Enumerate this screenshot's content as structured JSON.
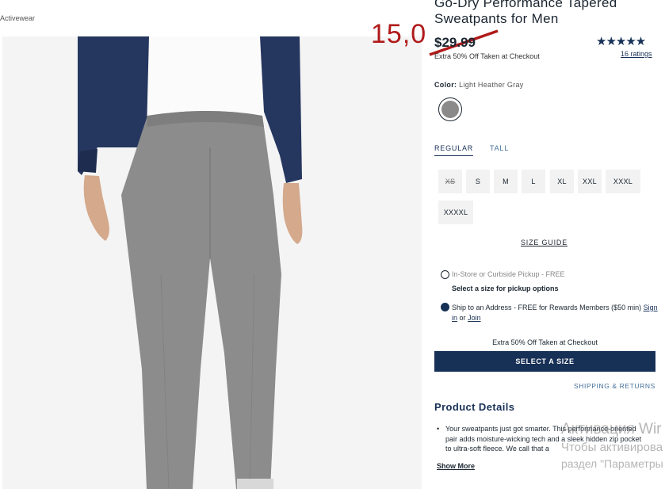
{
  "breadcrumb": "Activewear",
  "product": {
    "title": "Go-Dry Performance Tapered Sweatpants for Men",
    "price": "$29.99",
    "handwritten_price": "15,0",
    "promo_note": "Extra 50% Off Taken at Checkout",
    "stars": "★★★★★",
    "rating_value": 4.5,
    "ratings_label": "16 ratings",
    "color_label": "Color:",
    "color_value": "Light Heather Gray",
    "swatch_color": "#8a8a8a"
  },
  "fit_tabs": {
    "regular": "REGULAR",
    "tall": "TALL"
  },
  "sizes": [
    "XS",
    "S",
    "M",
    "L",
    "XL",
    "XXL",
    "XXXL",
    "XXXXL"
  ],
  "size_guide": "SIZE GUIDE",
  "fulfillment": {
    "pickup_label": "In-Store or Curbside Pickup - FREE",
    "pickup_hint": "Select a size for pickup options",
    "ship_label": "Ship to an Address - FREE for Rewards Members ($50 min)",
    "sign_in": "Sign in",
    "or": "or",
    "join": "Join"
  },
  "checkout_note": "Extra 50% Off Taken at Checkout",
  "cta_label": "SELECT A SIZE",
  "shipping_returns": "SHIPPING & RETURNS",
  "details": {
    "heading": "Product Details",
    "text": "Your sweatpants just got smarter. This performance-oriented pair adds moisture-wicking tech and a sleek hidden zip pocket to ultra-soft fleece. We call that a",
    "show_more": "Show More"
  },
  "watermark": {
    "line1": "Активация Wir",
    "line2": "Чтобы активирова",
    "line3": "раздел \"Параметры"
  },
  "colors": {
    "navy": "#173056",
    "accent_red": "#b01a1a",
    "link_blue": "#447099"
  }
}
